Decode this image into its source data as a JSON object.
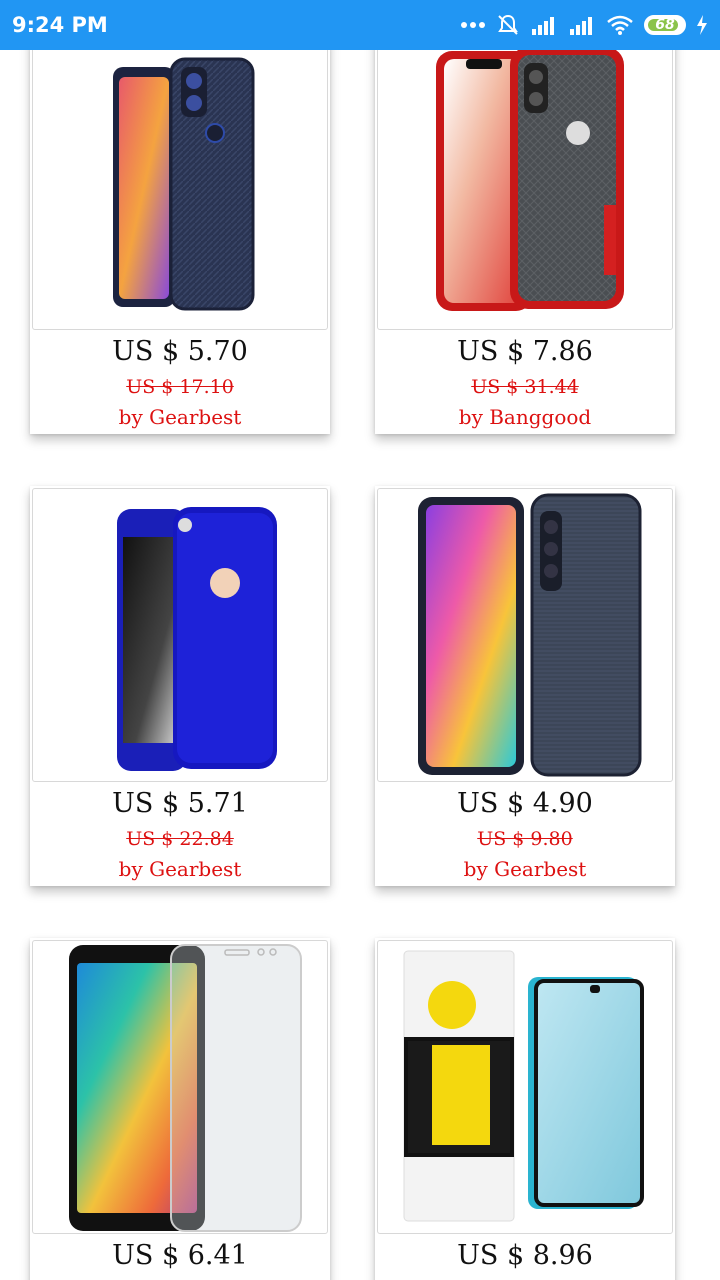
{
  "status_bar": {
    "time": "9:24 PM",
    "battery": "68"
  },
  "products": [
    {
      "price": "US $ 5.70",
      "old_price": "US $ 17.10",
      "vendor": "by Gearbest",
      "image": "redmi-carbon-case"
    },
    {
      "price": "US $ 7.86",
      "old_price": "US $ 31.44",
      "vendor": "by Banggood",
      "image": "iphone-red-case"
    },
    {
      "price": "US $ 5.71",
      "old_price": "US $ 22.84",
      "vendor": "by Gearbest",
      "image": "iphone-blue-case"
    },
    {
      "price": "US $ 4.90",
      "old_price": "US $ 9.80",
      "vendor": "by Gearbest",
      "image": "mi-brushed-case"
    },
    {
      "price": "US $ 6.41",
      "old_price": "",
      "vendor": "",
      "image": "screen-protector"
    },
    {
      "price": "US $ 8.96",
      "old_price": "",
      "vendor": "",
      "image": "tempered-glass"
    }
  ]
}
